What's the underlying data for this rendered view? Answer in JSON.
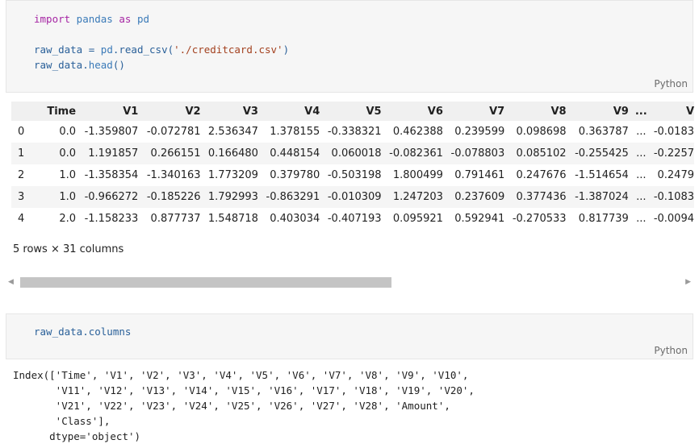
{
  "cell1": {
    "lines": [
      [
        {
          "t": "import",
          "c": "kw"
        },
        {
          "t": " pandas ",
          "c": "mod"
        },
        {
          "t": "as",
          "c": "kw"
        },
        {
          "t": " pd",
          "c": "mod"
        }
      ],
      [],
      [
        {
          "t": "raw_data = ",
          "c": ""
        },
        {
          "t": "pd",
          "c": "mod"
        },
        {
          "t": ".read_csv(",
          "c": ""
        },
        {
          "t": "'./creditcard.csv'",
          "c": "str"
        },
        {
          "t": ")",
          "c": ""
        }
      ],
      [
        {
          "t": "raw_data.",
          "c": ""
        },
        {
          "t": "head",
          "c": "mod"
        },
        {
          "t": "()",
          "c": ""
        }
      ]
    ],
    "language": "Python"
  },
  "dataframe": {
    "columns": [
      "",
      "Time",
      "V1",
      "V2",
      "V3",
      "V4",
      "V5",
      "V6",
      "V7",
      "V8",
      "V9",
      "...",
      "V"
    ],
    "rows": [
      [
        "0",
        "0.0",
        "-1.359807",
        "-0.072781",
        "2.536347",
        "1.378155",
        "-0.338321",
        "0.462388",
        "0.239599",
        "0.098698",
        "0.363787",
        "...",
        "-0.0183"
      ],
      [
        "1",
        "0.0",
        "1.191857",
        "0.266151",
        "0.166480",
        "0.448154",
        "0.060018",
        "-0.082361",
        "-0.078803",
        "0.085102",
        "-0.255425",
        "...",
        "-0.2257"
      ],
      [
        "2",
        "1.0",
        "-1.358354",
        "-1.340163",
        "1.773209",
        "0.379780",
        "-0.503198",
        "1.800499",
        "0.791461",
        "0.247676",
        "-1.514654",
        "...",
        "0.2479"
      ],
      [
        "3",
        "1.0",
        "-0.966272",
        "-0.185226",
        "1.792993",
        "-0.863291",
        "-0.010309",
        "1.247203",
        "0.237609",
        "0.377436",
        "-1.387024",
        "...",
        "-0.1083"
      ],
      [
        "4",
        "2.0",
        "-1.158233",
        "0.877737",
        "1.548718",
        "0.403034",
        "-0.407193",
        "0.095921",
        "0.592941",
        "-0.270533",
        "0.817739",
        "...",
        "-0.0094"
      ]
    ],
    "shape_note": "5 rows × 31 columns"
  },
  "scrollbar": {
    "left_arrow": "◀",
    "right_arrow": "▶"
  },
  "cell2": {
    "code": "raw_data.columns",
    "language": "Python"
  },
  "output2": "Index(['Time', 'V1', 'V2', 'V3', 'V4', 'V5', 'V6', 'V7', 'V8', 'V9', 'V10',\n       'V11', 'V12', 'V13', 'V14', 'V15', 'V16', 'V17', 'V18', 'V19', 'V20',\n       'V21', 'V22', 'V23', 'V24', 'V25', 'V26', 'V27', 'V28', 'Amount',\n       'Class'],\n      dtype='object')"
}
